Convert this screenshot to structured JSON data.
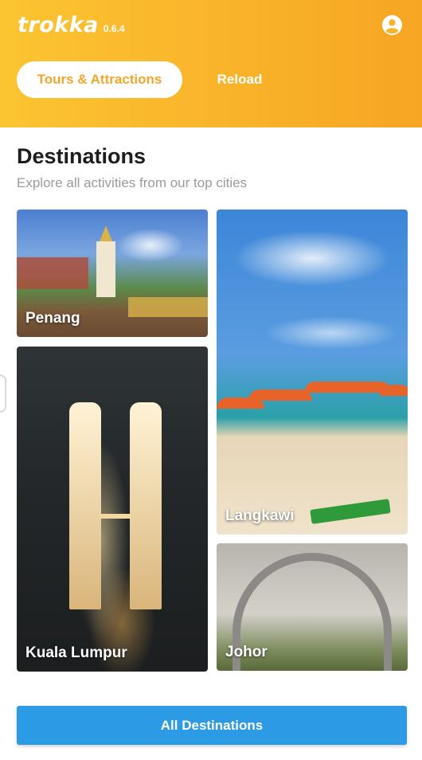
{
  "app": {
    "logo_text": "trokka",
    "version": "0.6.4"
  },
  "header": {
    "tabs": [
      {
        "label": "Tours & Attractions",
        "active": true
      },
      {
        "label": "Reload",
        "active": false
      }
    ],
    "profile_icon": "account-circle-icon"
  },
  "section": {
    "title": "Destinations",
    "subtitle": "Explore all activities from our top cities"
  },
  "destinations": [
    {
      "name": "Penang"
    },
    {
      "name": "Kuala Lumpur"
    },
    {
      "name": "Langkawi"
    },
    {
      "name": "Johor"
    }
  ],
  "footer": {
    "button_label": "All Destinations"
  },
  "colors": {
    "header_start": "#fbc531",
    "header_end": "#f6a623",
    "accent_text": "#f4a62a",
    "button_blue": "#2d9ae6"
  }
}
